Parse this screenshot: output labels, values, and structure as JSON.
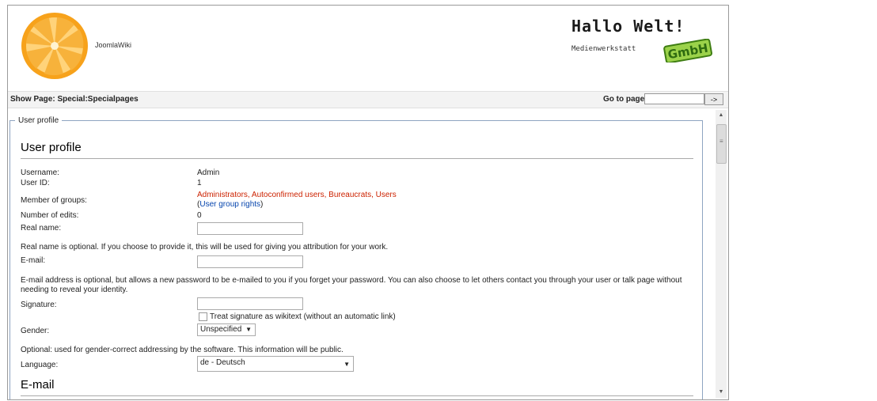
{
  "header": {
    "site_name": "JoomlaWiki",
    "brand_title": "Hallo Welt!",
    "brand_subtitle": "Medienwerkstatt",
    "brand_badge": "GmbH",
    "accent_color": "#f5a623"
  },
  "toolbar": {
    "title": "Show Page: Special:Specialpages",
    "goto_label": "Go to page:",
    "goto_value": "",
    "goto_button": "->"
  },
  "profile": {
    "legend": "User profile",
    "heading": "User profile",
    "username_label": "Username:",
    "username_value": "Admin",
    "userid_label": "User ID:",
    "userid_value": "1",
    "groups_label": "Member of groups:",
    "groups_value": "Administrators, Autoconfirmed users, Bureaucrats, Users",
    "group_rights_open": "(",
    "group_rights_link": "User group rights",
    "group_rights_close": ")",
    "edits_label": "Number of edits:",
    "edits_value": "0",
    "realname_label": "Real name:",
    "realname_value": "",
    "realname_help": "Real name is optional. If you choose to provide it, this will be used for giving you attribution for your work.",
    "email_label": "E-mail:",
    "email_value": "",
    "email_help": "E-mail address is optional, but allows a new password to be e-mailed to you if you forget your password. You can also choose to let others contact you through your user or talk page without needing to reveal your identity.",
    "signature_label": "Signature:",
    "signature_value": "",
    "wikitext_checkbox_label": "Treat signature as wikitext (without an automatic link)",
    "gender_label": "Gender:",
    "gender_value": "Unspecified",
    "gender_help": "Optional: used for gender-correct addressing by the software. This information will be public.",
    "language_label": "Language:",
    "language_value": "de - Deutsch",
    "email_section_heading": "E-mail"
  }
}
